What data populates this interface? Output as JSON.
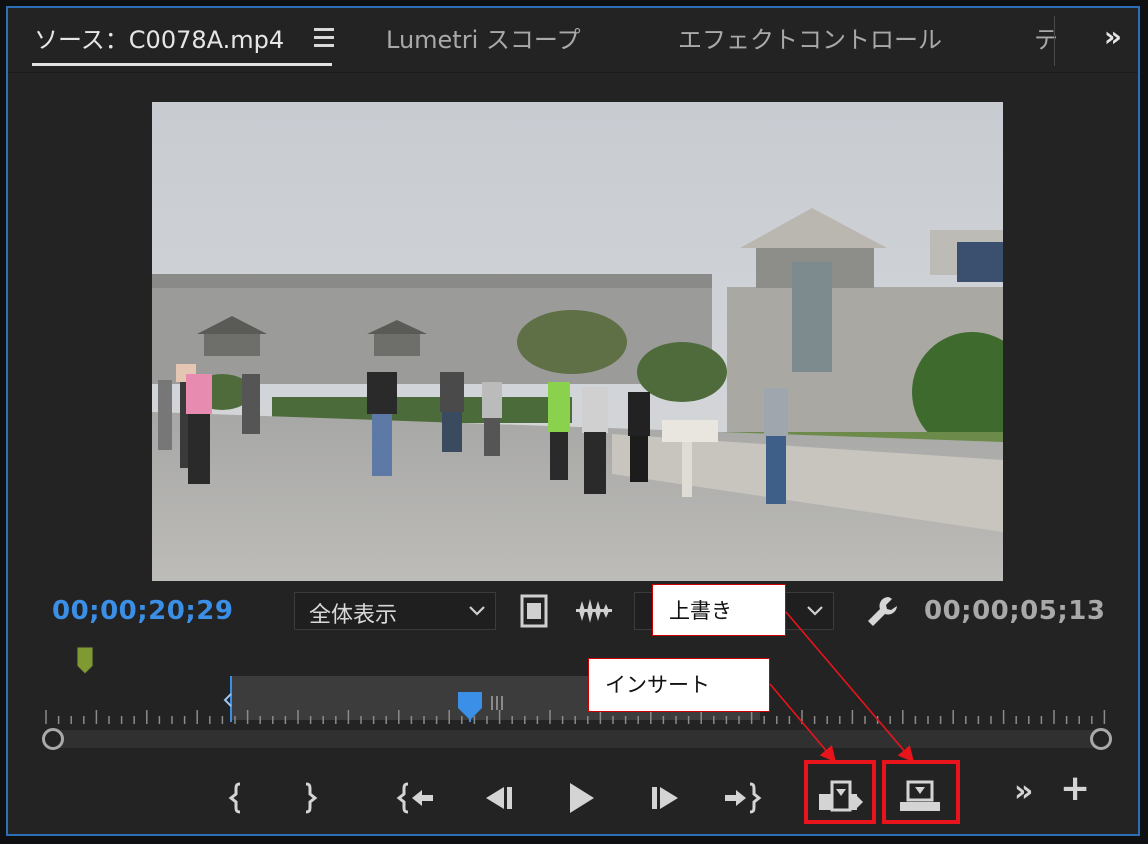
{
  "tabs": {
    "source_label": "ソース：C0078A.mp4",
    "lumetri_label": "Lumetri スコープ",
    "effects_label": "エフェクトコントロール",
    "truncated_label": "テ",
    "overflow_label": "»"
  },
  "monitor": {
    "current_timecode": "00;00;20;29",
    "duration_timecode": "00;00;05;13",
    "zoom_select": "全体表示",
    "resolution_select": ""
  },
  "callouts": {
    "overwrite": "上書き",
    "insert": "インサート"
  },
  "transport": {
    "more_label": "»",
    "add_label": "+"
  },
  "colors": {
    "timecode": "#3b8fe6",
    "highlight": "#e8141c",
    "playhead": "#3b8fe6",
    "in_marker": "#7f9a33"
  }
}
